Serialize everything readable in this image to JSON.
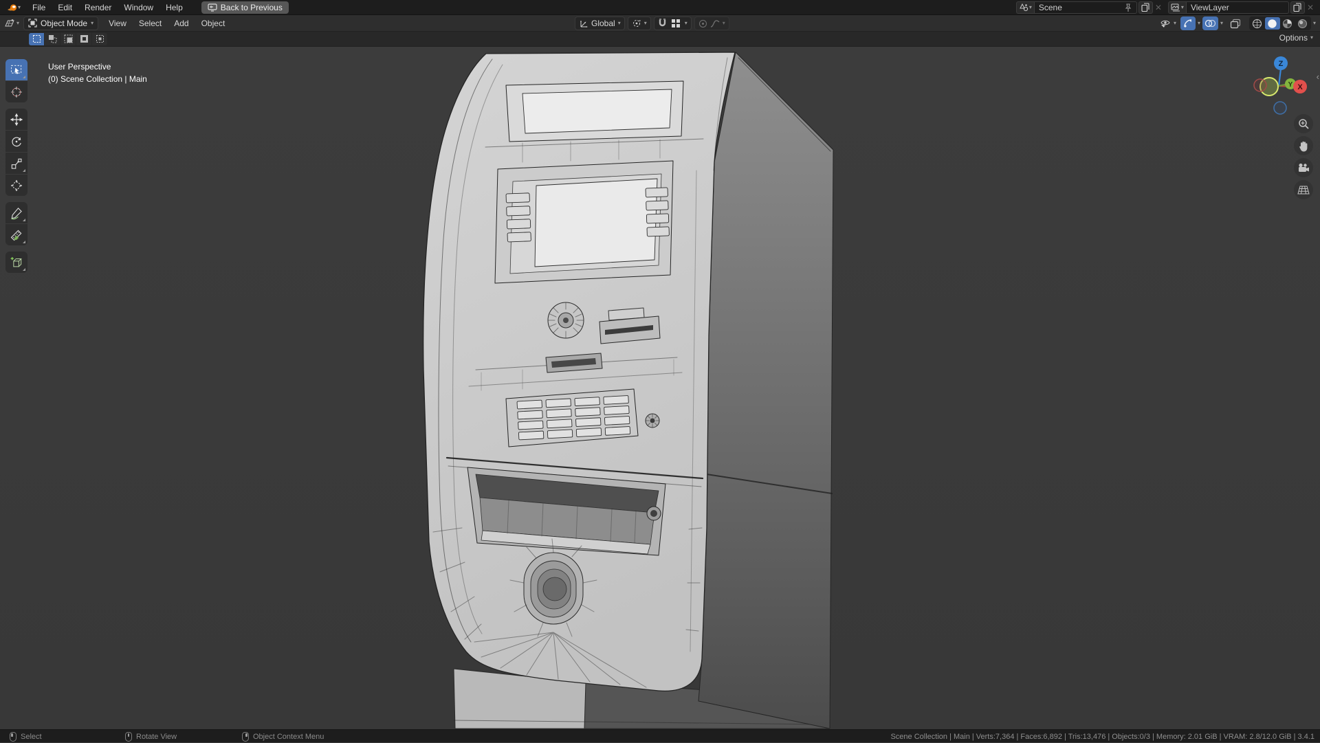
{
  "topbar": {
    "menus": [
      "File",
      "Edit",
      "Render",
      "Window",
      "Help"
    ],
    "back_button_label": "Back to Previous",
    "scene_selector": {
      "label": "Scene"
    },
    "viewlayer_selector": {
      "label": "ViewLayer"
    }
  },
  "viewport_header": {
    "mode": "Object Mode",
    "menus": [
      "View",
      "Select",
      "Add",
      "Object"
    ],
    "transform_orientation": "Global"
  },
  "tool_settings": {
    "options_label": "Options",
    "select_modes": [
      "Set",
      "Extend",
      "Subtract",
      "Invert",
      "Intersect"
    ]
  },
  "toolbar": {
    "tools": [
      "Select Box",
      "Cursor",
      "Move",
      "Rotate",
      "Scale",
      "Transform",
      "Annotate",
      "Measure",
      "Add Cube"
    ]
  },
  "viewport": {
    "overlay": {
      "line1": "User Perspective",
      "line2": "(0) Scene Collection | Main"
    },
    "axis_labels": {
      "x": "X",
      "y": "Y",
      "z": "Z"
    }
  },
  "status_bar": {
    "hints": [
      {
        "icon": "mouse-left",
        "label": "Select"
      },
      {
        "icon": "mouse-middle",
        "label": "Rotate View"
      },
      {
        "icon": "mouse-right",
        "label": "Object Context Menu"
      }
    ],
    "stats": "Scene Collection | Main | Verts:7,364 | Faces:6,892 | Tris:13,476 | Objects:0/3 | Memory: 2.01 GiB | VRAM: 2.8/12.0 GiB | 3.4.1"
  },
  "colors": {
    "accent": "#4772b3",
    "axis_x": "#e2504c",
    "axis_y": "#84b43e",
    "axis_z": "#3a87d8",
    "viewport_bg": "#3a3a3a"
  }
}
